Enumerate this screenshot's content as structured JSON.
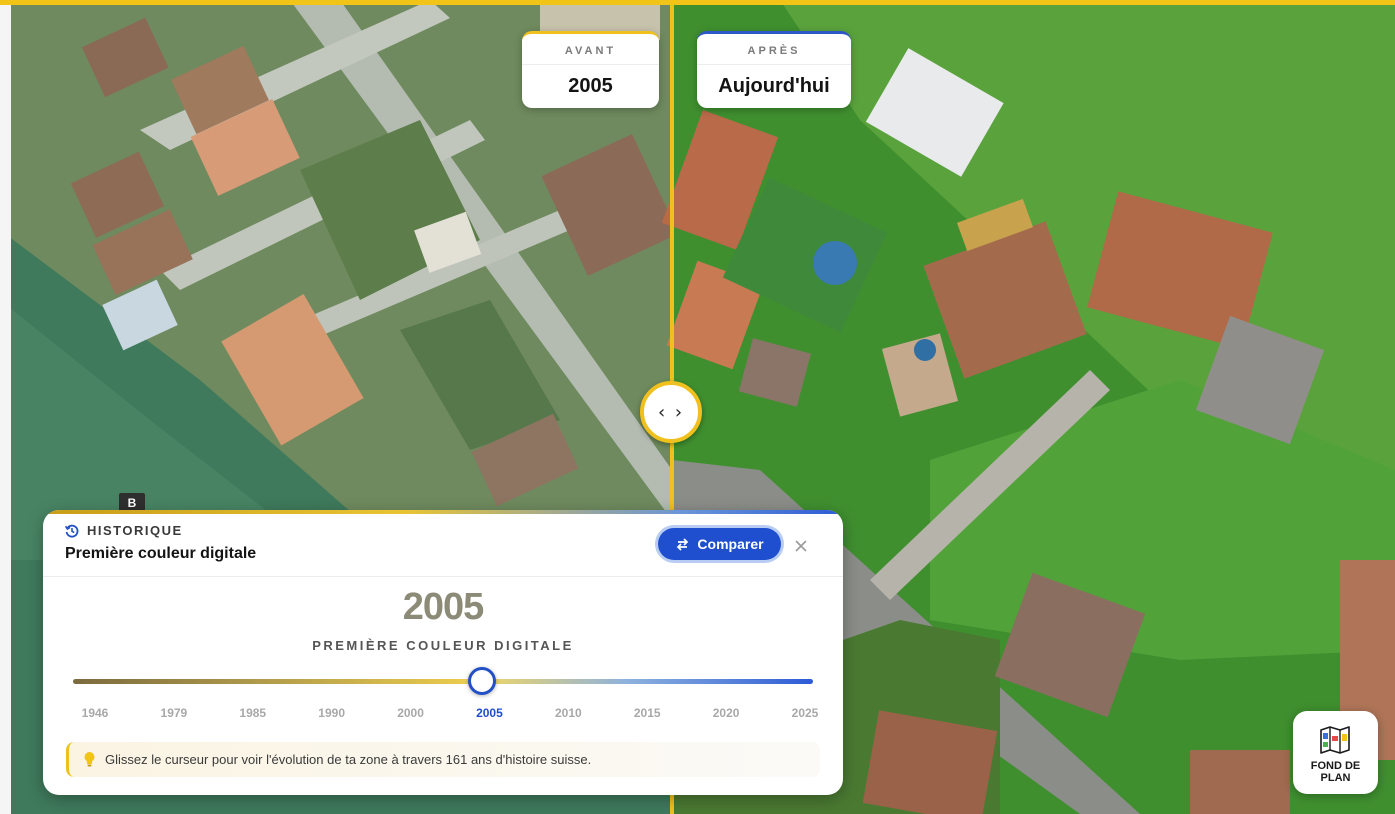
{
  "compare": {
    "before_kicker": "AVANT",
    "before_value": "2005",
    "after_kicker": "APRÈS",
    "after_value": "Aujourd'hui"
  },
  "map": {
    "marker_label": "B"
  },
  "panel": {
    "kicker": "HISTORIQUE",
    "title": "Première couleur digitale",
    "compare_button": "Comparer",
    "year": "2005",
    "subtitle": "PREMIÈRE COULEUR DIGITALE",
    "slider_ticks": [
      "1946",
      "1979",
      "1985",
      "1990",
      "2000",
      "2005",
      "2010",
      "2015",
      "2020",
      "2025"
    ],
    "active_tick_index": 5,
    "hint": "Glissez le curseur pour voir l'évolution de ta zone à travers 161 ans d'histoire suisse."
  },
  "fond_button": {
    "label_line1": "FOND DE",
    "label_line2": "PLAN"
  },
  "colors": {
    "accent_yellow": "#f0c11e",
    "accent_blue": "#1f4fcf"
  }
}
